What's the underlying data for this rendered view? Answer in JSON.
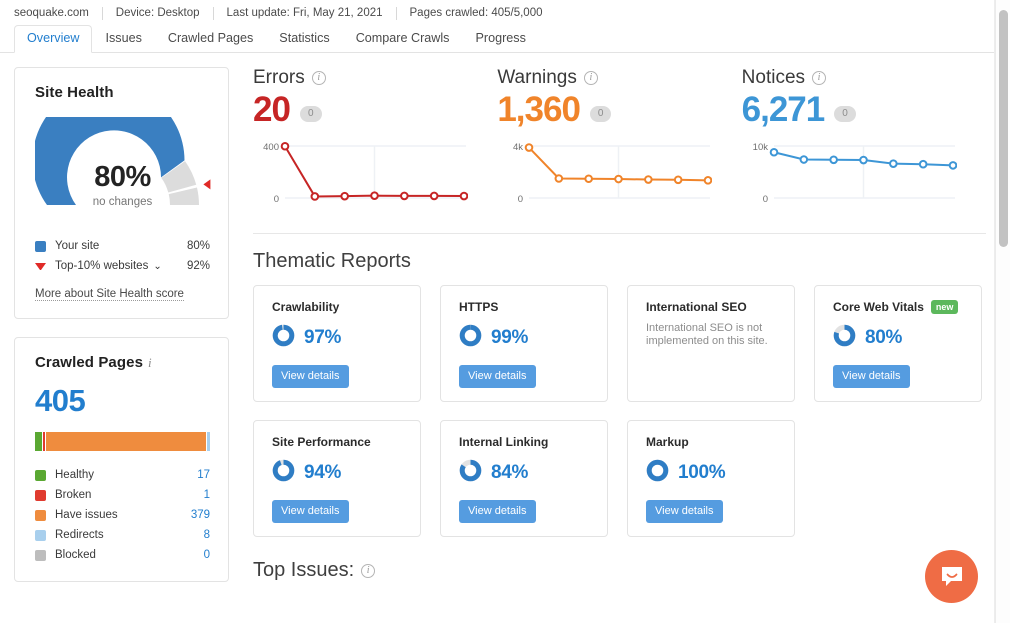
{
  "meta": {
    "domain": "seoquake.com",
    "device": "Device: Desktop",
    "last_update": "Last update: Fri, May 21, 2021",
    "pages_crawled": "Pages crawled: 405/5,000"
  },
  "tabs": [
    {
      "label": "Overview",
      "active": true
    },
    {
      "label": "Issues",
      "active": false
    },
    {
      "label": "Crawled Pages",
      "active": false
    },
    {
      "label": "Statistics",
      "active": false
    },
    {
      "label": "Compare Crawls",
      "active": false
    },
    {
      "label": "Progress",
      "active": false
    }
  ],
  "site_health": {
    "title": "Site Health",
    "score": "80%",
    "change": "no changes",
    "score_value": 80,
    "benchmark_value": 92,
    "legend": [
      {
        "label": "Your site",
        "value": "80%",
        "swatch": "#3a7fc1",
        "type": "square"
      },
      {
        "label": "Top-10% websites",
        "value": "92%",
        "swatch": "#e02a27",
        "type": "triangle",
        "caret": "⌄"
      }
    ],
    "link": "More about Site Health score",
    "colors": {
      "arc": "#3a7fc1",
      "rest": "#dcdcdc",
      "marker": "#e02a27"
    }
  },
  "crawled_pages": {
    "title": "Crawled Pages",
    "info_icon": "info-icon",
    "total": "405",
    "segments": [
      {
        "label": "Healthy",
        "value": "17",
        "count": 17,
        "color": "#5aa832"
      },
      {
        "label": "Broken",
        "value": "1",
        "count": 1,
        "color": "#e03b2f"
      },
      {
        "label": "Have issues",
        "value": "379",
        "count": 379,
        "color": "#ef8c3e"
      },
      {
        "label": "Redirects",
        "value": "8",
        "count": 8,
        "color": "#a8cfed"
      },
      {
        "label": "Blocked",
        "value": "0",
        "count": 0,
        "color": "#bdbdbd"
      }
    ]
  },
  "stats": [
    {
      "name": "Errors",
      "value": "20",
      "badge": "0",
      "color": "#c62525",
      "chart_data": {
        "type": "line",
        "title": "Errors",
        "ylabel": "",
        "xlabel": "",
        "ylim": [
          0,
          400
        ],
        "ytick_labels": [
          "400",
          "0"
        ],
        "values": [
          398,
          12,
          14,
          18,
          16,
          16,
          15
        ],
        "x": [
          1,
          2,
          3,
          4,
          5,
          6,
          7
        ],
        "grid": true,
        "legend": "none",
        "color": "#c62525"
      }
    },
    {
      "name": "Warnings",
      "value": "1,360",
      "badge": "0",
      "color": "#f0842a",
      "chart_data": {
        "type": "line",
        "title": "Warnings",
        "ylabel": "",
        "xlabel": "",
        "ylim": [
          0,
          4000
        ],
        "ytick_labels": [
          "4k",
          "0"
        ],
        "values": [
          3880,
          1500,
          1480,
          1460,
          1420,
          1400,
          1360
        ],
        "x": [
          1,
          2,
          3,
          4,
          5,
          6,
          7
        ],
        "grid": true,
        "legend": "none",
        "color": "#f0842a"
      }
    },
    {
      "name": "Notices",
      "value": "6,271",
      "badge": "0",
      "color": "#3d96d6",
      "chart_data": {
        "type": "line",
        "title": "Notices",
        "ylabel": "",
        "xlabel": "",
        "ylim": [
          0,
          10000
        ],
        "ytick_labels": [
          "10k",
          "0"
        ],
        "values": [
          8800,
          7400,
          7350,
          7300,
          6600,
          6500,
          6271
        ],
        "x": [
          1,
          2,
          3,
          4,
          5,
          6,
          7
        ],
        "grid": true,
        "legend": "none",
        "color": "#3d96d6"
      }
    }
  ],
  "thematic": {
    "heading": "Thematic Reports",
    "button_label": "View details",
    "cards": [
      {
        "title": "Crawlability",
        "pct": "97%",
        "value": 97,
        "has_ring": true,
        "has_button": true
      },
      {
        "title": "HTTPS",
        "pct": "99%",
        "value": 99,
        "has_ring": true,
        "has_button": true
      },
      {
        "title": "International SEO",
        "desc": "International SEO is not implemented on this site.",
        "has_ring": false,
        "has_button": false
      },
      {
        "title": "Core Web Vitals",
        "pct": "80%",
        "value": 80,
        "badge": "new",
        "has_ring": true,
        "has_button": true
      },
      {
        "title": "Site Performance",
        "pct": "94%",
        "value": 94,
        "has_ring": true,
        "has_button": true
      },
      {
        "title": "Internal Linking",
        "pct": "84%",
        "value": 84,
        "has_ring": true,
        "has_button": true
      },
      {
        "title": "Markup",
        "pct": "100%",
        "value": 100,
        "has_ring": true,
        "has_button": true
      }
    ]
  },
  "top_issues": {
    "heading": "Top Issues:"
  },
  "chat": {
    "icon": "chat-bubble-icon",
    "color": "#ef6c45"
  }
}
